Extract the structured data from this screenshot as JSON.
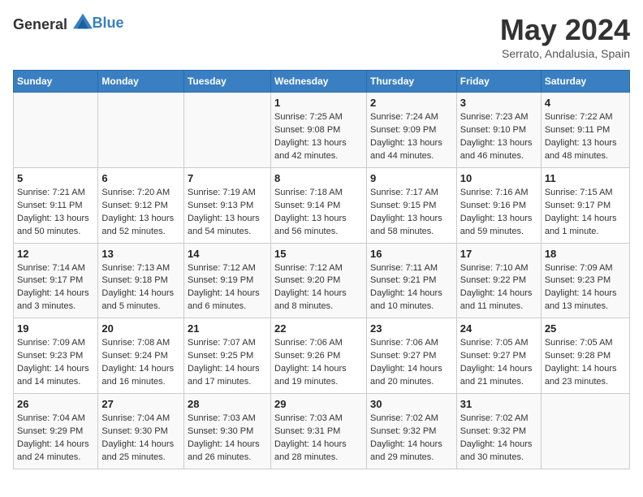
{
  "header": {
    "logo_general": "General",
    "logo_blue": "Blue",
    "title": "May 2024",
    "subtitle": "Serrato, Andalusia, Spain"
  },
  "days_of_week": [
    "Sunday",
    "Monday",
    "Tuesday",
    "Wednesday",
    "Thursday",
    "Friday",
    "Saturday"
  ],
  "weeks": [
    {
      "days": [
        {
          "number": "",
          "sunrise": "",
          "sunset": "",
          "daylight": ""
        },
        {
          "number": "",
          "sunrise": "",
          "sunset": "",
          "daylight": ""
        },
        {
          "number": "",
          "sunrise": "",
          "sunset": "",
          "daylight": ""
        },
        {
          "number": "1",
          "sunrise": "Sunrise: 7:25 AM",
          "sunset": "Sunset: 9:08 PM",
          "daylight": "Daylight: 13 hours and 42 minutes."
        },
        {
          "number": "2",
          "sunrise": "Sunrise: 7:24 AM",
          "sunset": "Sunset: 9:09 PM",
          "daylight": "Daylight: 13 hours and 44 minutes."
        },
        {
          "number": "3",
          "sunrise": "Sunrise: 7:23 AM",
          "sunset": "Sunset: 9:10 PM",
          "daylight": "Daylight: 13 hours and 46 minutes."
        },
        {
          "number": "4",
          "sunrise": "Sunrise: 7:22 AM",
          "sunset": "Sunset: 9:11 PM",
          "daylight": "Daylight: 13 hours and 48 minutes."
        }
      ]
    },
    {
      "days": [
        {
          "number": "5",
          "sunrise": "Sunrise: 7:21 AM",
          "sunset": "Sunset: 9:11 PM",
          "daylight": "Daylight: 13 hours and 50 minutes."
        },
        {
          "number": "6",
          "sunrise": "Sunrise: 7:20 AM",
          "sunset": "Sunset: 9:12 PM",
          "daylight": "Daylight: 13 hours and 52 minutes."
        },
        {
          "number": "7",
          "sunrise": "Sunrise: 7:19 AM",
          "sunset": "Sunset: 9:13 PM",
          "daylight": "Daylight: 13 hours and 54 minutes."
        },
        {
          "number": "8",
          "sunrise": "Sunrise: 7:18 AM",
          "sunset": "Sunset: 9:14 PM",
          "daylight": "Daylight: 13 hours and 56 minutes."
        },
        {
          "number": "9",
          "sunrise": "Sunrise: 7:17 AM",
          "sunset": "Sunset: 9:15 PM",
          "daylight": "Daylight: 13 hours and 58 minutes."
        },
        {
          "number": "10",
          "sunrise": "Sunrise: 7:16 AM",
          "sunset": "Sunset: 9:16 PM",
          "daylight": "Daylight: 13 hours and 59 minutes."
        },
        {
          "number": "11",
          "sunrise": "Sunrise: 7:15 AM",
          "sunset": "Sunset: 9:17 PM",
          "daylight": "Daylight: 14 hours and 1 minute."
        }
      ]
    },
    {
      "days": [
        {
          "number": "12",
          "sunrise": "Sunrise: 7:14 AM",
          "sunset": "Sunset: 9:17 PM",
          "daylight": "Daylight: 14 hours and 3 minutes."
        },
        {
          "number": "13",
          "sunrise": "Sunrise: 7:13 AM",
          "sunset": "Sunset: 9:18 PM",
          "daylight": "Daylight: 14 hours and 5 minutes."
        },
        {
          "number": "14",
          "sunrise": "Sunrise: 7:12 AM",
          "sunset": "Sunset: 9:19 PM",
          "daylight": "Daylight: 14 hours and 6 minutes."
        },
        {
          "number": "15",
          "sunrise": "Sunrise: 7:12 AM",
          "sunset": "Sunset: 9:20 PM",
          "daylight": "Daylight: 14 hours and 8 minutes."
        },
        {
          "number": "16",
          "sunrise": "Sunrise: 7:11 AM",
          "sunset": "Sunset: 9:21 PM",
          "daylight": "Daylight: 14 hours and 10 minutes."
        },
        {
          "number": "17",
          "sunrise": "Sunrise: 7:10 AM",
          "sunset": "Sunset: 9:22 PM",
          "daylight": "Daylight: 14 hours and 11 minutes."
        },
        {
          "number": "18",
          "sunrise": "Sunrise: 7:09 AM",
          "sunset": "Sunset: 9:23 PM",
          "daylight": "Daylight: 14 hours and 13 minutes."
        }
      ]
    },
    {
      "days": [
        {
          "number": "19",
          "sunrise": "Sunrise: 7:09 AM",
          "sunset": "Sunset: 9:23 PM",
          "daylight": "Daylight: 14 hours and 14 minutes."
        },
        {
          "number": "20",
          "sunrise": "Sunrise: 7:08 AM",
          "sunset": "Sunset: 9:24 PM",
          "daylight": "Daylight: 14 hours and 16 minutes."
        },
        {
          "number": "21",
          "sunrise": "Sunrise: 7:07 AM",
          "sunset": "Sunset: 9:25 PM",
          "daylight": "Daylight: 14 hours and 17 minutes."
        },
        {
          "number": "22",
          "sunrise": "Sunrise: 7:06 AM",
          "sunset": "Sunset: 9:26 PM",
          "daylight": "Daylight: 14 hours and 19 minutes."
        },
        {
          "number": "23",
          "sunrise": "Sunrise: 7:06 AM",
          "sunset": "Sunset: 9:27 PM",
          "daylight": "Daylight: 14 hours and 20 minutes."
        },
        {
          "number": "24",
          "sunrise": "Sunrise: 7:05 AM",
          "sunset": "Sunset: 9:27 PM",
          "daylight": "Daylight: 14 hours and 21 minutes."
        },
        {
          "number": "25",
          "sunrise": "Sunrise: 7:05 AM",
          "sunset": "Sunset: 9:28 PM",
          "daylight": "Daylight: 14 hours and 23 minutes."
        }
      ]
    },
    {
      "days": [
        {
          "number": "26",
          "sunrise": "Sunrise: 7:04 AM",
          "sunset": "Sunset: 9:29 PM",
          "daylight": "Daylight: 14 hours and 24 minutes."
        },
        {
          "number": "27",
          "sunrise": "Sunrise: 7:04 AM",
          "sunset": "Sunset: 9:30 PM",
          "daylight": "Daylight: 14 hours and 25 minutes."
        },
        {
          "number": "28",
          "sunrise": "Sunrise: 7:03 AM",
          "sunset": "Sunset: 9:30 PM",
          "daylight": "Daylight: 14 hours and 26 minutes."
        },
        {
          "number": "29",
          "sunrise": "Sunrise: 7:03 AM",
          "sunset": "Sunset: 9:31 PM",
          "daylight": "Daylight: 14 hours and 28 minutes."
        },
        {
          "number": "30",
          "sunrise": "Sunrise: 7:02 AM",
          "sunset": "Sunset: 9:32 PM",
          "daylight": "Daylight: 14 hours and 29 minutes."
        },
        {
          "number": "31",
          "sunrise": "Sunrise: 7:02 AM",
          "sunset": "Sunset: 9:32 PM",
          "daylight": "Daylight: 14 hours and 30 minutes."
        },
        {
          "number": "",
          "sunrise": "",
          "sunset": "",
          "daylight": ""
        }
      ]
    }
  ]
}
